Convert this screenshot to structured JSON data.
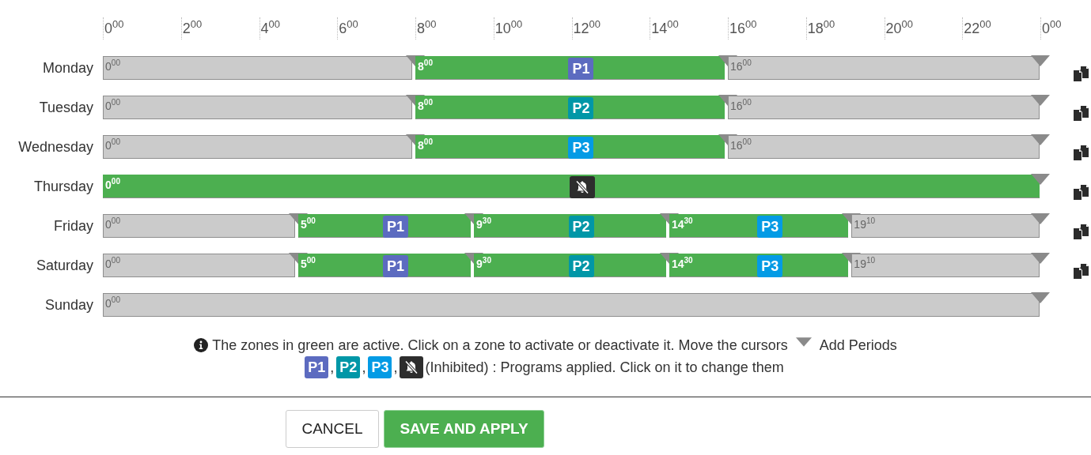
{
  "axis": {
    "ticks": [
      {
        "hour": "0",
        "minutes": "00"
      },
      {
        "hour": "2",
        "minutes": "00"
      },
      {
        "hour": "4",
        "minutes": "00"
      },
      {
        "hour": "6",
        "minutes": "00"
      },
      {
        "hour": "8",
        "minutes": "00"
      },
      {
        "hour": "10",
        "minutes": "00"
      },
      {
        "hour": "12",
        "minutes": "00"
      },
      {
        "hour": "14",
        "minutes": "00"
      },
      {
        "hour": "16",
        "minutes": "00"
      },
      {
        "hour": "18",
        "minutes": "00"
      },
      {
        "hour": "20",
        "minutes": "00"
      },
      {
        "hour": "22",
        "minutes": "00"
      },
      {
        "hour": "0",
        "minutes": "00"
      }
    ]
  },
  "days": [
    {
      "name": "Monday",
      "copyable": true,
      "segments": [
        {
          "hour": "0",
          "minutes": "00",
          "active": false
        },
        {
          "hour": "8",
          "minutes": "00",
          "active": true,
          "program": {
            "kind": "p1",
            "label": "P1"
          }
        },
        {
          "hour": "16",
          "minutes": "00",
          "active": false
        }
      ]
    },
    {
      "name": "Tuesday",
      "copyable": true,
      "segments": [
        {
          "hour": "0",
          "minutes": "00",
          "active": false
        },
        {
          "hour": "8",
          "minutes": "00",
          "active": true,
          "program": {
            "kind": "p2",
            "label": "P2"
          }
        },
        {
          "hour": "16",
          "minutes": "00",
          "active": false
        }
      ]
    },
    {
      "name": "Wednesday",
      "copyable": true,
      "segments": [
        {
          "hour": "0",
          "minutes": "00",
          "active": false
        },
        {
          "hour": "8",
          "minutes": "00",
          "active": true,
          "program": {
            "kind": "p3",
            "label": "P3"
          }
        },
        {
          "hour": "16",
          "minutes": "00",
          "active": false
        }
      ]
    },
    {
      "name": "Thursday",
      "copyable": true,
      "segments": [
        {
          "hour": "0",
          "minutes": "00",
          "active": true,
          "program": {
            "kind": "inhibited"
          }
        }
      ]
    },
    {
      "name": "Friday",
      "copyable": true,
      "segments": [
        {
          "hour": "0",
          "minutes": "00",
          "active": false
        },
        {
          "hour": "5",
          "minutes": "00",
          "active": true,
          "program": {
            "kind": "p1",
            "label": "P1"
          }
        },
        {
          "hour": "9",
          "minutes": "30",
          "active": true,
          "program": {
            "kind": "p2",
            "label": "P2"
          }
        },
        {
          "hour": "14",
          "minutes": "30",
          "active": true,
          "program": {
            "kind": "p3",
            "label": "P3"
          }
        },
        {
          "hour": "19",
          "minutes": "10",
          "active": false
        }
      ]
    },
    {
      "name": "Saturday",
      "copyable": true,
      "segments": [
        {
          "hour": "0",
          "minutes": "00",
          "active": false
        },
        {
          "hour": "5",
          "minutes": "00",
          "active": true,
          "program": {
            "kind": "p1",
            "label": "P1"
          }
        },
        {
          "hour": "9",
          "minutes": "30",
          "active": true,
          "program": {
            "kind": "p2",
            "label": "P2"
          }
        },
        {
          "hour": "14",
          "minutes": "30",
          "active": true,
          "program": {
            "kind": "p3",
            "label": "P3"
          }
        },
        {
          "hour": "19",
          "minutes": "10",
          "active": false
        }
      ]
    },
    {
      "name": "Sunday",
      "copyable": false,
      "segments": [
        {
          "hour": "0",
          "minutes": "00",
          "active": false
        }
      ]
    }
  ],
  "legend": {
    "info": "The zones in green are active. Click on a zone to activate or deactivate it. Move the cursors",
    "add_periods": "Add Periods",
    "programs": [
      {
        "kind": "p1",
        "label": "P1",
        "after": ","
      },
      {
        "kind": "p2",
        "label": "P2",
        "after": ","
      },
      {
        "kind": "p3",
        "label": "P3",
        "after": ","
      },
      {
        "kind": "inhibited",
        "after": "(Inhibited) : Programs applied. Click on it to change them"
      }
    ]
  },
  "buttons": [
    {
      "kind": "secondary",
      "label": "CANCEL"
    },
    {
      "kind": "primary",
      "label": "SAVE AND APPLY"
    }
  ]
}
